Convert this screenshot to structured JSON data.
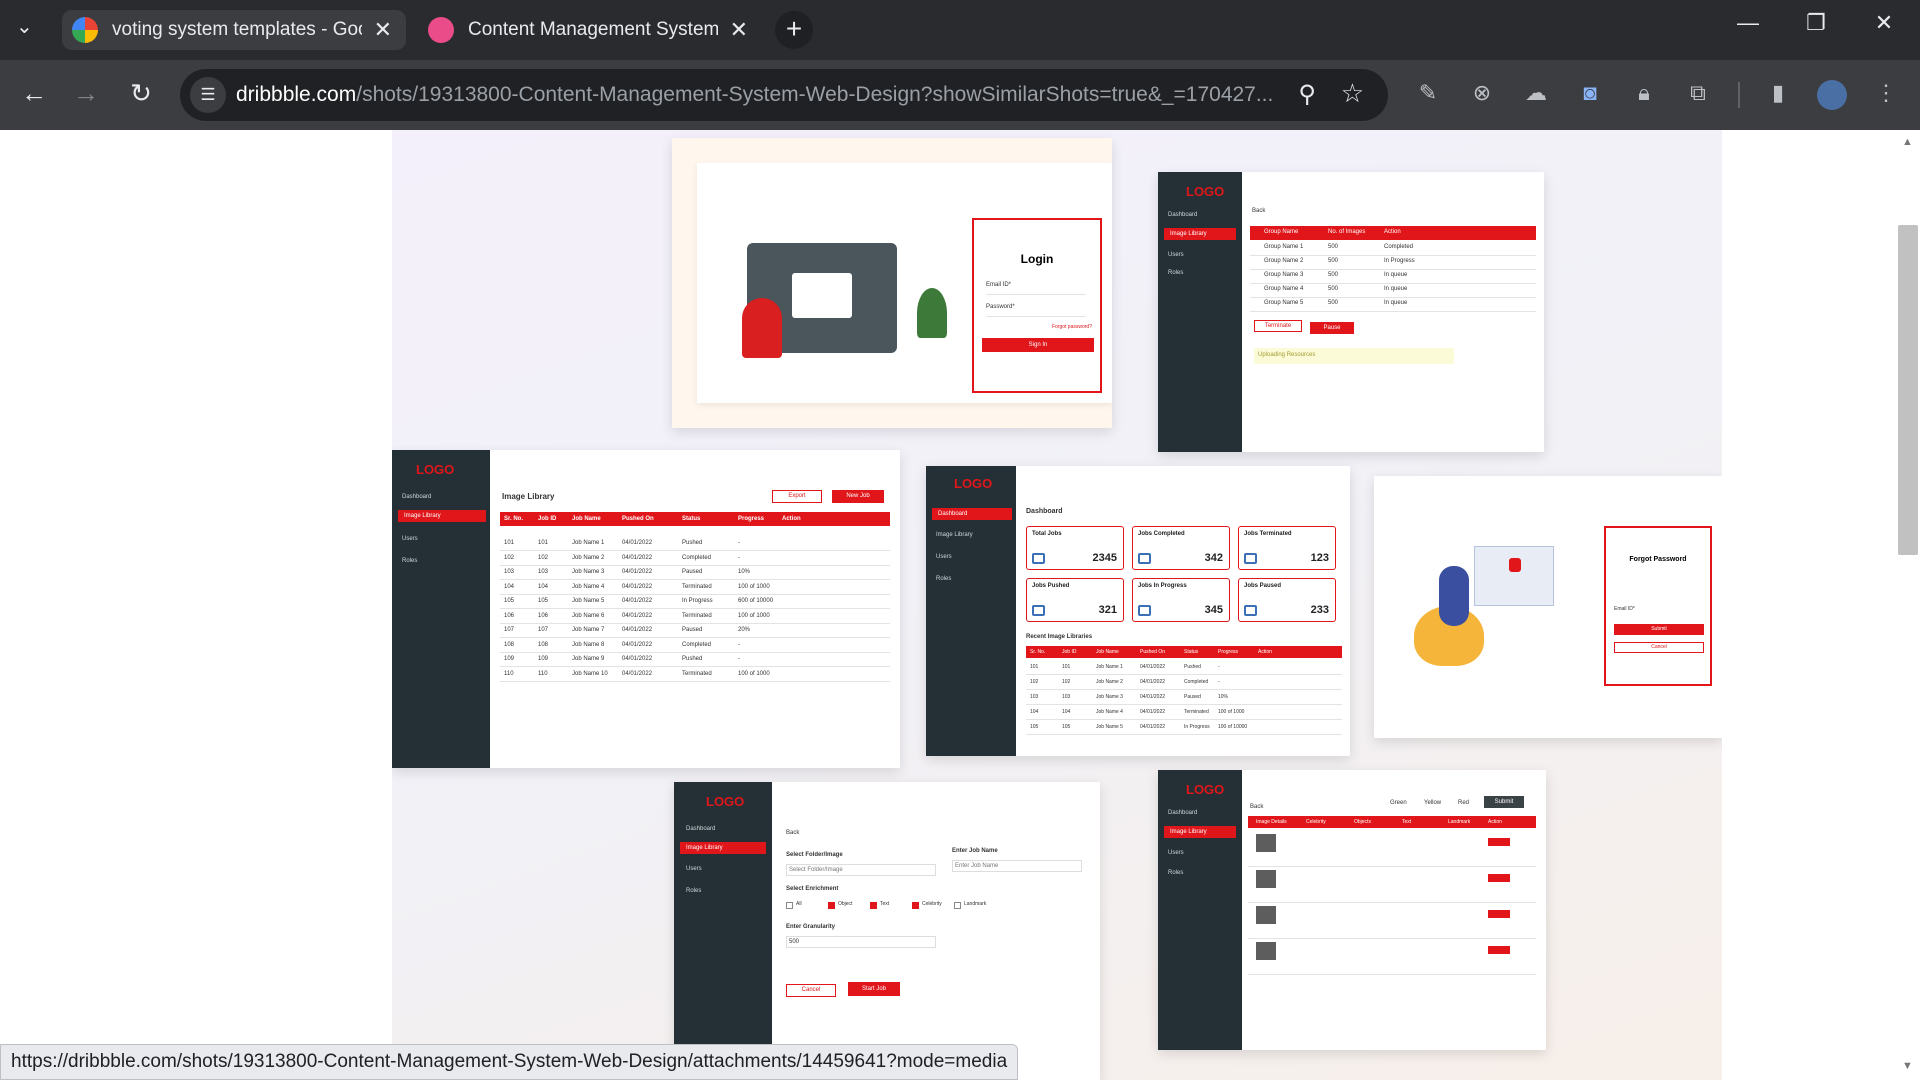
{
  "browser": {
    "tabs": [
      {
        "title": "voting system templates - Goog",
        "favicon": "google-icon"
      },
      {
        "title": "Content Management System |",
        "favicon": "dribbble-icon"
      }
    ],
    "url_domain": "dribbble.com",
    "url_path": "/shots/19313800-Content-Management-System-Web-Design?showSimilarShots=true&_=170427...",
    "status_url": "https://dribbble.com/shots/19313800-Content-Management-System-Web-Design/attachments/14459641?mode=media"
  },
  "shot": {
    "login": {
      "title": "Login",
      "email": "Email ID*",
      "password": "Password*",
      "forgot": "Forgot password?",
      "button": "Sign In"
    },
    "group": {
      "logo": "LOGO",
      "menu": [
        "Dashboard",
        "Image Library",
        "Users",
        "Roles"
      ],
      "back": "Back",
      "headers": [
        "Group Name",
        "No. of Images",
        "Action"
      ],
      "rows": [
        [
          "Group Name 1",
          "500",
          "Completed"
        ],
        [
          "Group Name 2",
          "500",
          "In Progress"
        ],
        [
          "Group Name 3",
          "500",
          "In queue"
        ],
        [
          "Group Name 4",
          "500",
          "In queue"
        ],
        [
          "Group Name 5",
          "500",
          "In queue"
        ]
      ],
      "terminate": "Terminate",
      "pause": "Pause",
      "uploading": "Uploading Resources"
    },
    "library": {
      "logo": "LOGO",
      "menu": [
        "Dashboard",
        "Image Library",
        "Users",
        "Roles"
      ],
      "title": "Image Library",
      "export": "Export",
      "new_job": "New Job",
      "headers": [
        "Sr. No.",
        "Job ID",
        "Job Name",
        "Pushed On",
        "Status",
        "Progress",
        "Action"
      ],
      "rows": [
        [
          "101",
          "101",
          "Job Name 1",
          "04/01/2022",
          "Pushed",
          "-"
        ],
        [
          "102",
          "102",
          "Job Name 2",
          "04/01/2022",
          "Completed",
          "-"
        ],
        [
          "103",
          "103",
          "Job Name 3",
          "04/01/2022",
          "Paused",
          "10%"
        ],
        [
          "104",
          "104",
          "Job Name 4",
          "04/01/2022",
          "Terminated",
          "100 of 1000"
        ],
        [
          "105",
          "105",
          "Job Name 5",
          "04/01/2022",
          "In Progress",
          "600 of 10000"
        ],
        [
          "106",
          "106",
          "Job Name 6",
          "04/01/2022",
          "Terminated",
          "100 of 1000"
        ],
        [
          "107",
          "107",
          "Job Name 7",
          "04/01/2022",
          "Paused",
          "20%"
        ],
        [
          "108",
          "108",
          "Job Name 8",
          "04/01/2022",
          "Completed",
          "-"
        ],
        [
          "109",
          "109",
          "Job Name 9",
          "04/01/2022",
          "Pushed",
          "-"
        ],
        [
          "110",
          "110",
          "Job Name 10",
          "04/01/2022",
          "Terminated",
          "100 of 1000"
        ]
      ]
    },
    "dashboard": {
      "logo": "LOGO",
      "menu": [
        "Dashboard",
        "Image Library",
        "Users",
        "Roles"
      ],
      "title": "Dashboard",
      "stats": [
        {
          "label": "Total Jobs",
          "value": "2345"
        },
        {
          "label": "Jobs Completed",
          "value": "342"
        },
        {
          "label": "Jobs Terminated",
          "value": "123"
        },
        {
          "label": "Jobs Pushed",
          "value": "321"
        },
        {
          "label": "Jobs In Progress",
          "value": "345"
        },
        {
          "label": "Jobs Paused",
          "value": "233"
        }
      ],
      "recent": "Recent Image Libraries",
      "headers": [
        "Sr. No.",
        "Job ID",
        "Job Name",
        "Pushed On",
        "Status",
        "Progress",
        "Action"
      ],
      "rows": [
        [
          "101",
          "101",
          "Job Name 1",
          "04/01/2022",
          "Pushed",
          "-"
        ],
        [
          "102",
          "102",
          "Job Name 2",
          "04/01/2022",
          "Completed",
          "-"
        ],
        [
          "103",
          "103",
          "Job Name 3",
          "04/01/2022",
          "Paused",
          "10%"
        ],
        [
          "104",
          "104",
          "Job Name 4",
          "04/01/2022",
          "Terminated",
          "100 of 1000"
        ],
        [
          "105",
          "105",
          "Job Name 5",
          "04/01/2022",
          "In Progress",
          "100 of 10000"
        ]
      ]
    },
    "forgot": {
      "title": "Forgot Password",
      "email": "Email ID*",
      "submit": "Submit",
      "cancel": "Cancel"
    },
    "newjob": {
      "logo": "LOGO",
      "menu": [
        "Dashboard",
        "Image Library",
        "Users",
        "Roles"
      ],
      "back": "Back",
      "select_folder": "Select Folder/Image",
      "enter_job": "Enter Job Name",
      "enrichment": "Select Enrichment",
      "options": [
        "All",
        "Object",
        "Text",
        "Celebrity",
        "Landmark"
      ],
      "granularity": "Enter Granularity",
      "gran_value": "500",
      "cancel": "Cancel",
      "start": "Start Job"
    },
    "details": {
      "logo": "LOGO",
      "menu": [
        "Dashboard",
        "Image Library",
        "Users",
        "Roles"
      ],
      "back": "Back",
      "filters": [
        "Green",
        "Yellow",
        "Red"
      ],
      "submit": "Submit",
      "headers": [
        "Image Details",
        "Celebrity",
        "Objects",
        "Text",
        "Landmark",
        "Action"
      ]
    }
  }
}
